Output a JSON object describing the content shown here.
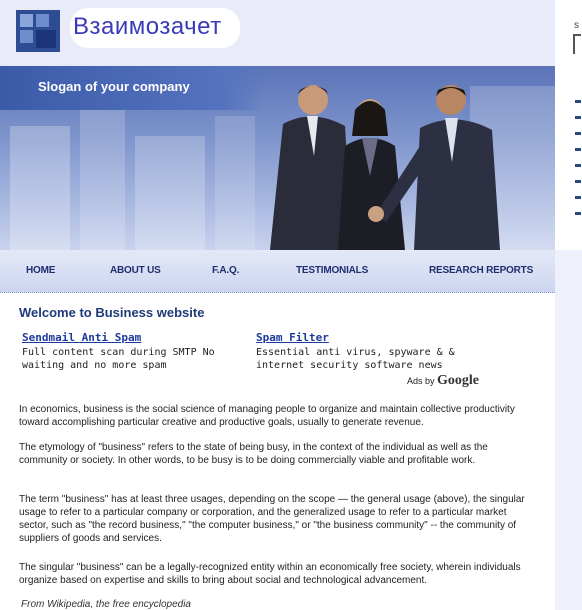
{
  "header": {
    "title": "Взаимозачет"
  },
  "banner": {
    "slogan": "Slogan of your company"
  },
  "nav": {
    "items": [
      "HOME",
      "ABOUT US",
      "F.A.Q.",
      "TESTIMONIALS",
      "RESEARCH REPORTS"
    ]
  },
  "main": {
    "welcome": "Welcome to Business website",
    "ads": [
      {
        "title": "Sendmail Anti Spam",
        "desc": "Full content scan during SMTP No waiting and no more spam"
      },
      {
        "title": "Spam Filter",
        "desc": "Essential anti virus, spyware & & internet security software news"
      }
    ],
    "ads_by": "Ads by",
    "ads_brand": "Google",
    "paragraphs": [
      "In economics, business is the social science of managing people to organize and maintain collective productivity toward accomplishing particular creative and productive goals, usually to generate revenue.",
      "The etymology of \"business\" refers to the state of being busy, in the context of the individual as well as the community or society. In other words, to be busy is to be doing commercially viable and profitable work.",
      "The term \"business\" has at least three usages, depending on the scope — the general usage (above), the singular usage to refer to a particular company or corporation, and the generalized usage to refer to a particular market sector, such as \"the record business,\" \"the computer business,\" or \"the business community\" -- the community of suppliers of goods and services.",
      "The singular \"business\" can be a legally-recognized entity within an economically free society, wherein individuals organize based on expertise and skills to bring about social and technological advancement."
    ],
    "source": "From Wikipedia, the free encyclopedia"
  },
  "colors": {
    "accent": "#2e4c94",
    "nav_text": "#1f2f6e",
    "link": "#1d3a9e"
  },
  "icons": {
    "logo": "blue-squares-logo-icon",
    "banner_image": "business-handshake-photo"
  }
}
